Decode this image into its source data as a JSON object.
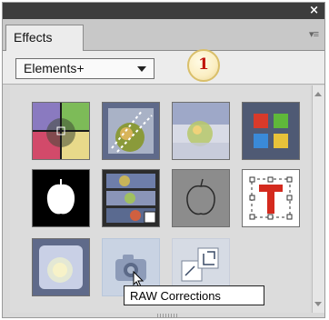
{
  "panel": {
    "close_glyph": "×",
    "tab_label": "Effects",
    "menu_icon": "panel-menu-icon"
  },
  "toolbar": {
    "dropdown_value": "Elements+",
    "callout_number": "1"
  },
  "effects": [
    {
      "name": "color-quadrant-effect"
    },
    {
      "name": "dashed-selection-effect"
    },
    {
      "name": "bright-blur-effect"
    },
    {
      "name": "color-blocks-effect"
    },
    {
      "name": "white-silhouette-effect"
    },
    {
      "name": "film-strip-effect"
    },
    {
      "name": "apple-outline-effect"
    },
    {
      "name": "text-transform-effect"
    },
    {
      "name": "soft-glow-effect"
    },
    {
      "name": "raw-corrections-effect"
    },
    {
      "name": "crop-transform-effect"
    }
  ],
  "tooltip": {
    "text": "RAW Corrections"
  },
  "colors": {
    "title_bar": "#3d3d3d",
    "panel_bg": "#dcdcdc",
    "thumb_frame": "#5f6a8a",
    "callout_red": "#c0140c"
  }
}
